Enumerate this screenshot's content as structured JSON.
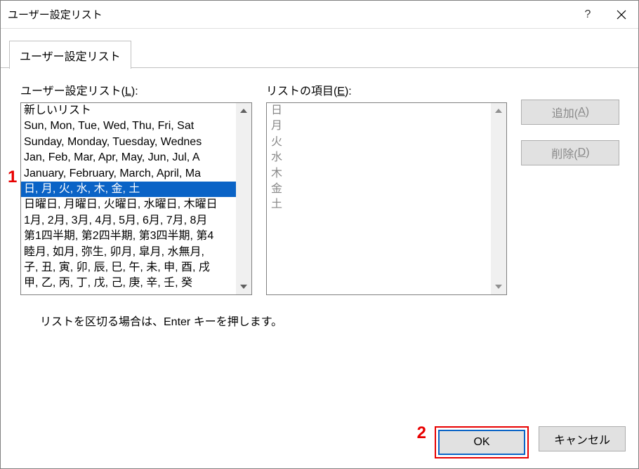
{
  "window": {
    "title": "ユーザー設定リスト",
    "help": "?",
    "close": "×"
  },
  "tab": {
    "label": "ユーザー設定リスト"
  },
  "leftCol": {
    "label": "ユーザー設定リスト(",
    "hotkey": "L",
    "labelEnd": "):"
  },
  "midCol": {
    "label": "リストの項目(",
    "hotkey": "E",
    "labelEnd": "):"
  },
  "lists": [
    {
      "text": "新しいリスト",
      "selected": false
    },
    {
      "text": "Sun, Mon, Tue, Wed, Thu, Fri, Sat",
      "selected": false
    },
    {
      "text": "Sunday, Monday, Tuesday, Wednes",
      "selected": false
    },
    {
      "text": "Jan, Feb, Mar, Apr, May, Jun, Jul, A",
      "selected": false
    },
    {
      "text": "January, February, March, April, Ma",
      "selected": false
    },
    {
      "text": "日, 月, 火, 水, 木, 金, 土",
      "selected": true
    },
    {
      "text": "日曜日, 月曜日, 火曜日, 水曜日, 木曜日",
      "selected": false
    },
    {
      "text": "1月, 2月, 3月, 4月, 5月, 6月, 7月, 8月",
      "selected": false
    },
    {
      "text": "第1四半期, 第2四半期, 第3四半期, 第4",
      "selected": false
    },
    {
      "text": "睦月, 如月, 弥生, 卯月, 皐月, 水無月,",
      "selected": false
    },
    {
      "text": "子, 丑, 寅, 卯, 辰, 巳, 午, 未, 申, 酉, 戌",
      "selected": false
    },
    {
      "text": "甲, 乙, 丙, 丁, 戊, 己, 庚, 辛, 壬, 癸",
      "selected": false
    }
  ],
  "items": [
    "日",
    "月",
    "火",
    "水",
    "木",
    "金",
    "土"
  ],
  "buttons": {
    "add": {
      "label": "追加(",
      "hotkey": "A",
      "labelEnd": ")"
    },
    "delete": {
      "label": "削除(",
      "hotkey": "D",
      "labelEnd": ")"
    },
    "ok": "OK",
    "cancel": "キャンセル"
  },
  "hint": "リストを区切る場合は、Enter キーを押します。",
  "annotations": {
    "a1": "1",
    "a2": "2"
  }
}
